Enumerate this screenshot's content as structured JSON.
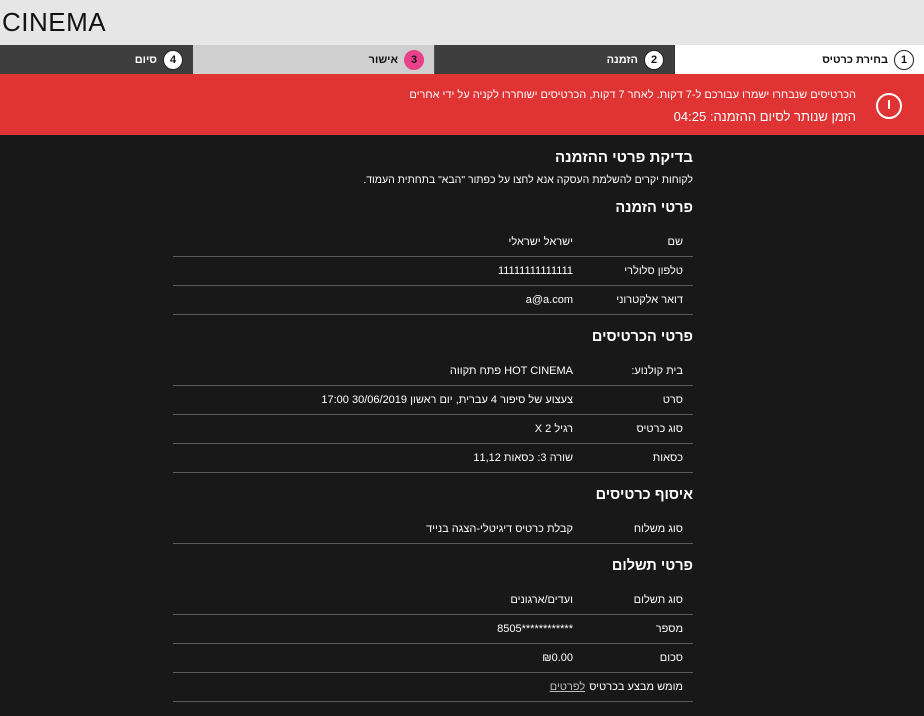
{
  "header": {
    "logo": "CINEMA"
  },
  "steps": [
    {
      "num": "1",
      "label": "בחירת כרטיס"
    },
    {
      "num": "2",
      "label": "הזמנה"
    },
    {
      "num": "3",
      "label": "אישור"
    },
    {
      "num": "4",
      "label": "סיום"
    }
  ],
  "alert": {
    "line1": "הכרטיסים שנבחרו ישמרו עבורכם ל-7 דקות. לאחר 7 דקות, הכרטיסים ישוחררו לקניה על ידי אחרים",
    "line2": "הזמן שנותר לסיום ההזמנה: 04:25",
    "colors": {
      "background": "#e03333"
    }
  },
  "main": {
    "title": "בדיקת פרטי ההזמנה",
    "intro": "לקוחות יקרים להשלמת העסקה אנא לחצו על כפתור \"הבא\" בתחתית העמוד.",
    "order": {
      "title": "פרטי הזמנה",
      "rows": [
        {
          "k": "שם",
          "v": "ישראל ישראלי"
        },
        {
          "k": "טלפון סלולרי",
          "v": "11111111111111"
        },
        {
          "k": "דואר אלקטרוני",
          "v": "a@a.com"
        }
      ]
    },
    "tickets": {
      "title": "פרטי הכרטיסים",
      "rows": [
        {
          "k": "בית קולנוע:",
          "v": "HOT CINEMA פתח תקווה"
        },
        {
          "k": "סרט",
          "v": "צעצוע של סיפור 4 עברית, יום ראשון 30/06/2019 17:00"
        },
        {
          "k": "סוג כרטיס",
          "v": "רגיל X 2"
        },
        {
          "k": "כסאות",
          "v": "שורה 3: כסאות 11,12"
        }
      ]
    },
    "pickup": {
      "title": "איסוף כרטיסים",
      "rows": [
        {
          "k": "סוג משלוח",
          "v": "קבלת כרטיס דיגיטלי-הצגה בנייד"
        }
      ]
    },
    "payment": {
      "title": "פרטי תשלום",
      "rows": [
        {
          "k": "סוג תשלום",
          "v": "ועדים/ארגונים"
        },
        {
          "k": "מספר",
          "v": "************8505"
        },
        {
          "k": "סכום",
          "v": "₪0.00"
        }
      ],
      "note": "מומש מבצע בכרטיס",
      "note_link": "לפרטים"
    }
  }
}
